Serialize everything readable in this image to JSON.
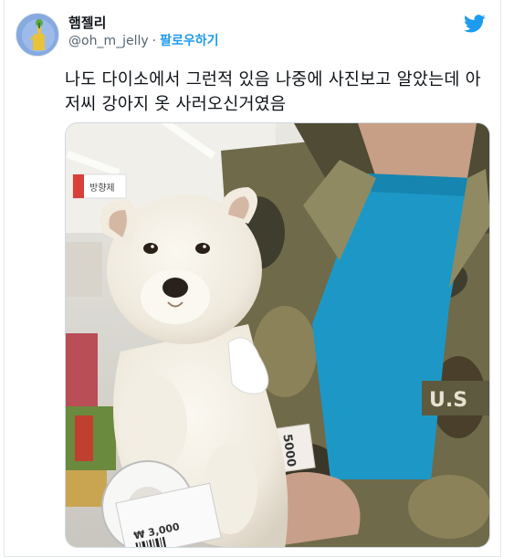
{
  "user": {
    "display_name": "햄젤리",
    "handle": "@oh_m_jelly",
    "separator": "·",
    "follow_label": "팔로우하기",
    "avatar_icon": "avatar-cartoon-icon"
  },
  "brand": {
    "logo_icon": "twitter-bird-icon",
    "color": "#1d9bf0"
  },
  "tweet": {
    "text": "나도 다이소에서 그런적 있음 나중에 사진보고 알았는데 아저씨 강아지 옷 사러오신거였음"
  },
  "media": {
    "description_icon": "puppy-photo-image",
    "price_tag_text": "5000",
    "shirt_patch_text": "U.S",
    "store_sign_text": "방향제",
    "tag_price_text": "₩ 3,000"
  }
}
